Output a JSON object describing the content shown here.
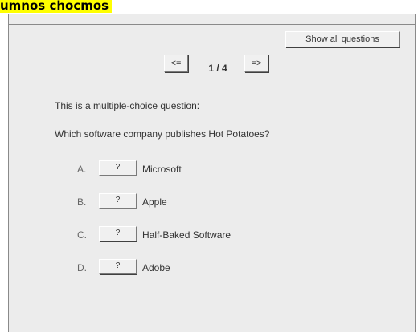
{
  "header": {
    "title": "umnos chocmos"
  },
  "toolbar": {
    "show_all_label": "Show all questions"
  },
  "navigation": {
    "prev_label": "<=",
    "next_label": "=>",
    "counter": "1 / 4"
  },
  "question": {
    "type_text": "This is a multiple-choice question:",
    "text": "Which software company publishes Hot Potatoes?",
    "answers": [
      {
        "letter": "A.",
        "button_label": "?",
        "text": "Microsoft"
      },
      {
        "letter": "B.",
        "button_label": "?",
        "text": "Apple"
      },
      {
        "letter": "C.",
        "button_label": "?",
        "text": "Half-Baked Software"
      },
      {
        "letter": "D.",
        "button_label": "?",
        "text": "Adobe"
      }
    ]
  },
  "colors": {
    "panel_background": "#ececec",
    "highlight": "#ffff00"
  }
}
